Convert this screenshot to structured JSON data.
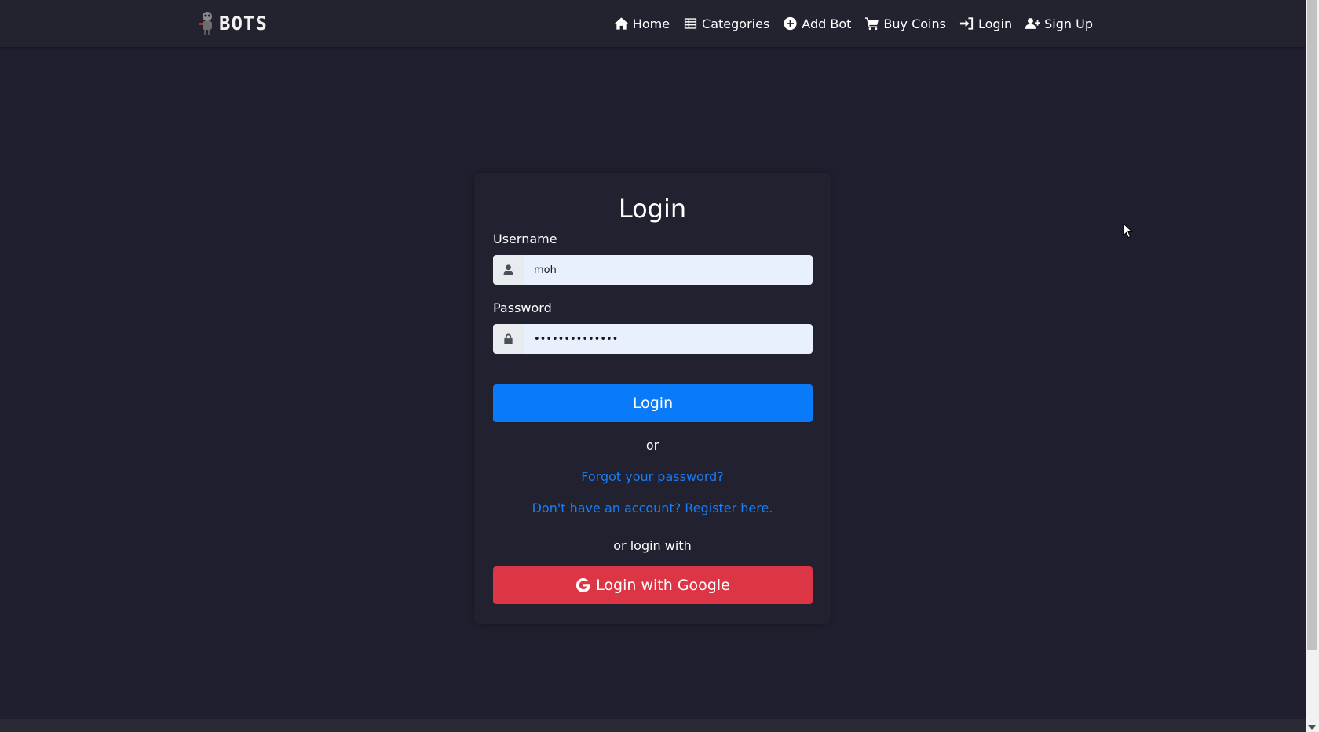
{
  "brand": {
    "logo_text": "BOTS"
  },
  "nav": {
    "items": [
      {
        "label": "Home",
        "icon": "home-icon"
      },
      {
        "label": "Categories",
        "icon": "list-icon"
      },
      {
        "label": "Add Bot",
        "icon": "plus-circle-icon"
      },
      {
        "label": "Buy Coins",
        "icon": "cart-icon"
      },
      {
        "label": "Login",
        "icon": "sign-in-icon"
      },
      {
        "label": "Sign Up",
        "icon": "user-plus-icon"
      }
    ]
  },
  "form": {
    "title": "Login",
    "username_label": "Username",
    "username_value": "moh",
    "password_label": "Password",
    "password_value": "••••••••••••••",
    "login_button": "Login",
    "or_text": "or",
    "forgot_link": "Forgot your password?",
    "register_link": "Don't have an account? Register here.",
    "or_login_with": "or login with",
    "google_button": "Login with Google"
  },
  "colors": {
    "background": "#1f1f2f",
    "primary": "#0a7bf8",
    "google": "#dc3545",
    "link": "#1a7df5"
  }
}
